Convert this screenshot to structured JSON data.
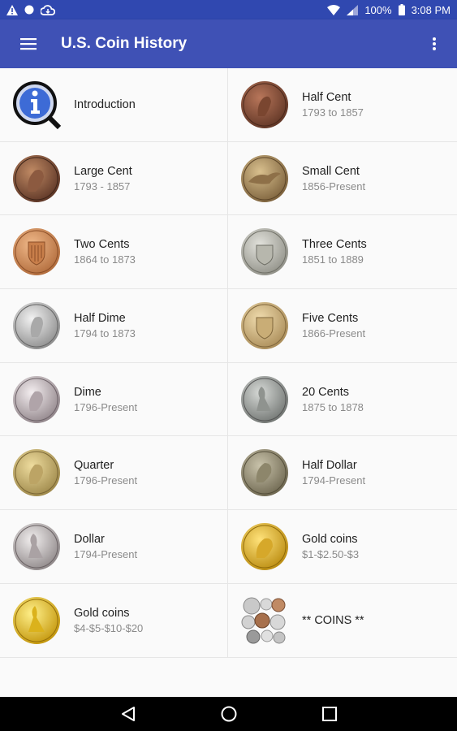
{
  "status_bar": {
    "battery": "100%",
    "time": "3:08 PM"
  },
  "app_bar": {
    "title": "U.S. Coin History",
    "menu_icon": "hamburger-menu-icon",
    "overflow_icon": "more-vert-icon"
  },
  "colors": {
    "app_bar": "#3f51b5",
    "status_bar": "#3048b0"
  },
  "items": [
    {
      "name": "Introduction",
      "sub": "",
      "icon": "info-magnifier-icon"
    },
    {
      "name": "Half Cent",
      "sub": "1793 to 1857",
      "icon": "half-cent-coin"
    },
    {
      "name": "Large Cent",
      "sub": "1793 - 1857",
      "icon": "large-cent-coin"
    },
    {
      "name": "Small Cent",
      "sub": "1856-Present",
      "icon": "small-cent-coin"
    },
    {
      "name": "Two Cents",
      "sub": "1864 to 1873",
      "icon": "two-cents-coin"
    },
    {
      "name": "Three Cents",
      "sub": "1851 to 1889",
      "icon": "three-cents-coin"
    },
    {
      "name": "Half Dime",
      "sub": "1794 to 1873",
      "icon": "half-dime-coin"
    },
    {
      "name": "Five Cents",
      "sub": "1866-Present",
      "icon": "five-cents-coin"
    },
    {
      "name": "Dime",
      "sub": "1796-Present",
      "icon": "dime-coin"
    },
    {
      "name": "20 Cents",
      "sub": "1875 to 1878",
      "icon": "twenty-cents-coin"
    },
    {
      "name": "Quarter",
      "sub": "1796-Present",
      "icon": "quarter-coin"
    },
    {
      "name": "Half Dollar",
      "sub": "1794-Present",
      "icon": "half-dollar-coin"
    },
    {
      "name": "Dollar",
      "sub": "1794-Present",
      "icon": "dollar-coin"
    },
    {
      "name": "Gold coins",
      "sub": "$1-$2.50-$3",
      "icon": "gold-coin-small"
    },
    {
      "name": "Gold coins",
      "sub": "$4-$5-$10-$20",
      "icon": "gold-coin-large"
    },
    {
      "name": "** COINS **",
      "sub": "",
      "icon": "coin-pile-icon"
    }
  ],
  "nav_bar": {
    "back_icon": "back-icon",
    "home_icon": "home-icon",
    "recents_icon": "recents-icon"
  }
}
